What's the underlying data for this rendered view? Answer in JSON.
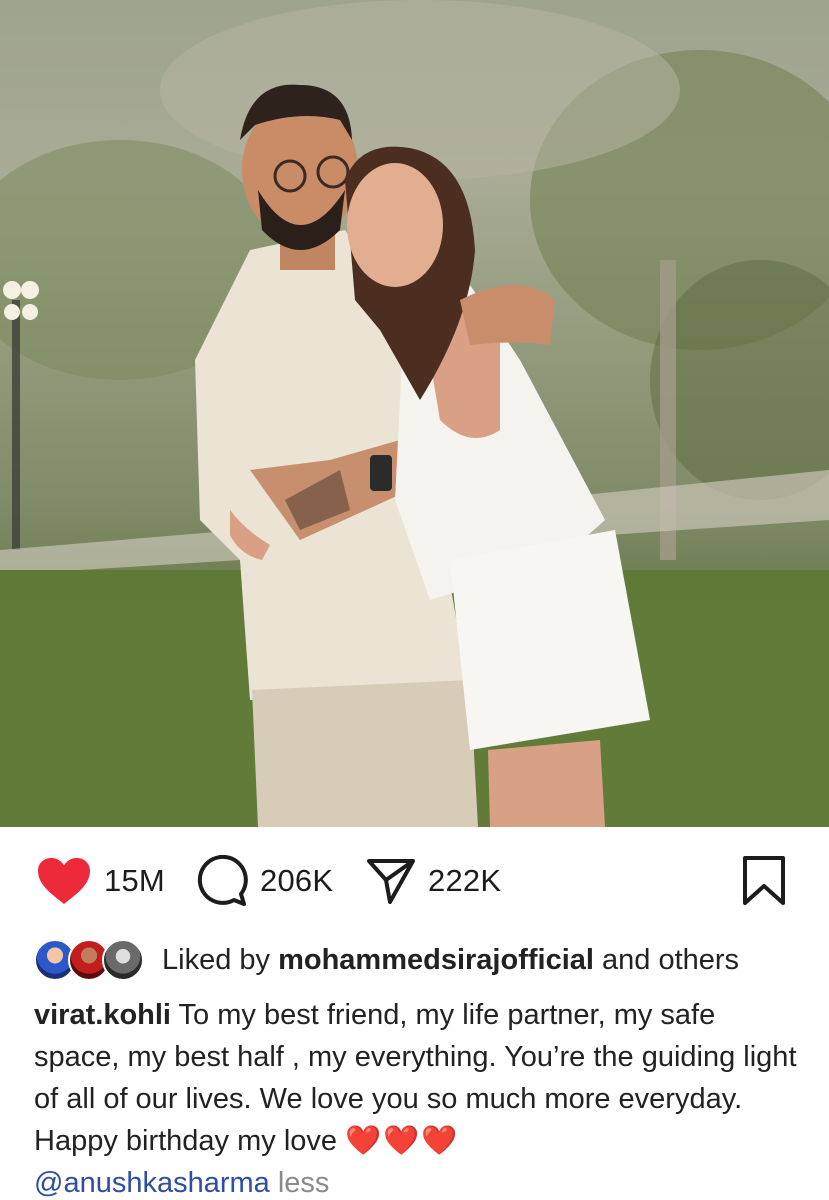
{
  "post": {
    "image_alt": "Couple photo"
  },
  "actions": {
    "like_count": "15M",
    "comment_count": "206K",
    "share_count": "222K"
  },
  "liked_by": {
    "prefix": "Liked by",
    "user": "mohammedsirajofficial",
    "suffix": "and others"
  },
  "caption": {
    "username": "virat.kohli",
    "text": "To my best friend, my life partner, my safe space, my best half , my everything. You’re the guiding light of all of our lives. We love you so much more everyday. Happy birthday my love",
    "hearts": "❤️❤️❤️",
    "mention": "@anushkasharma",
    "less_label": "less"
  },
  "colors": {
    "like_red": "#ed2a3a",
    "mention_blue": "#2d4fa1"
  }
}
